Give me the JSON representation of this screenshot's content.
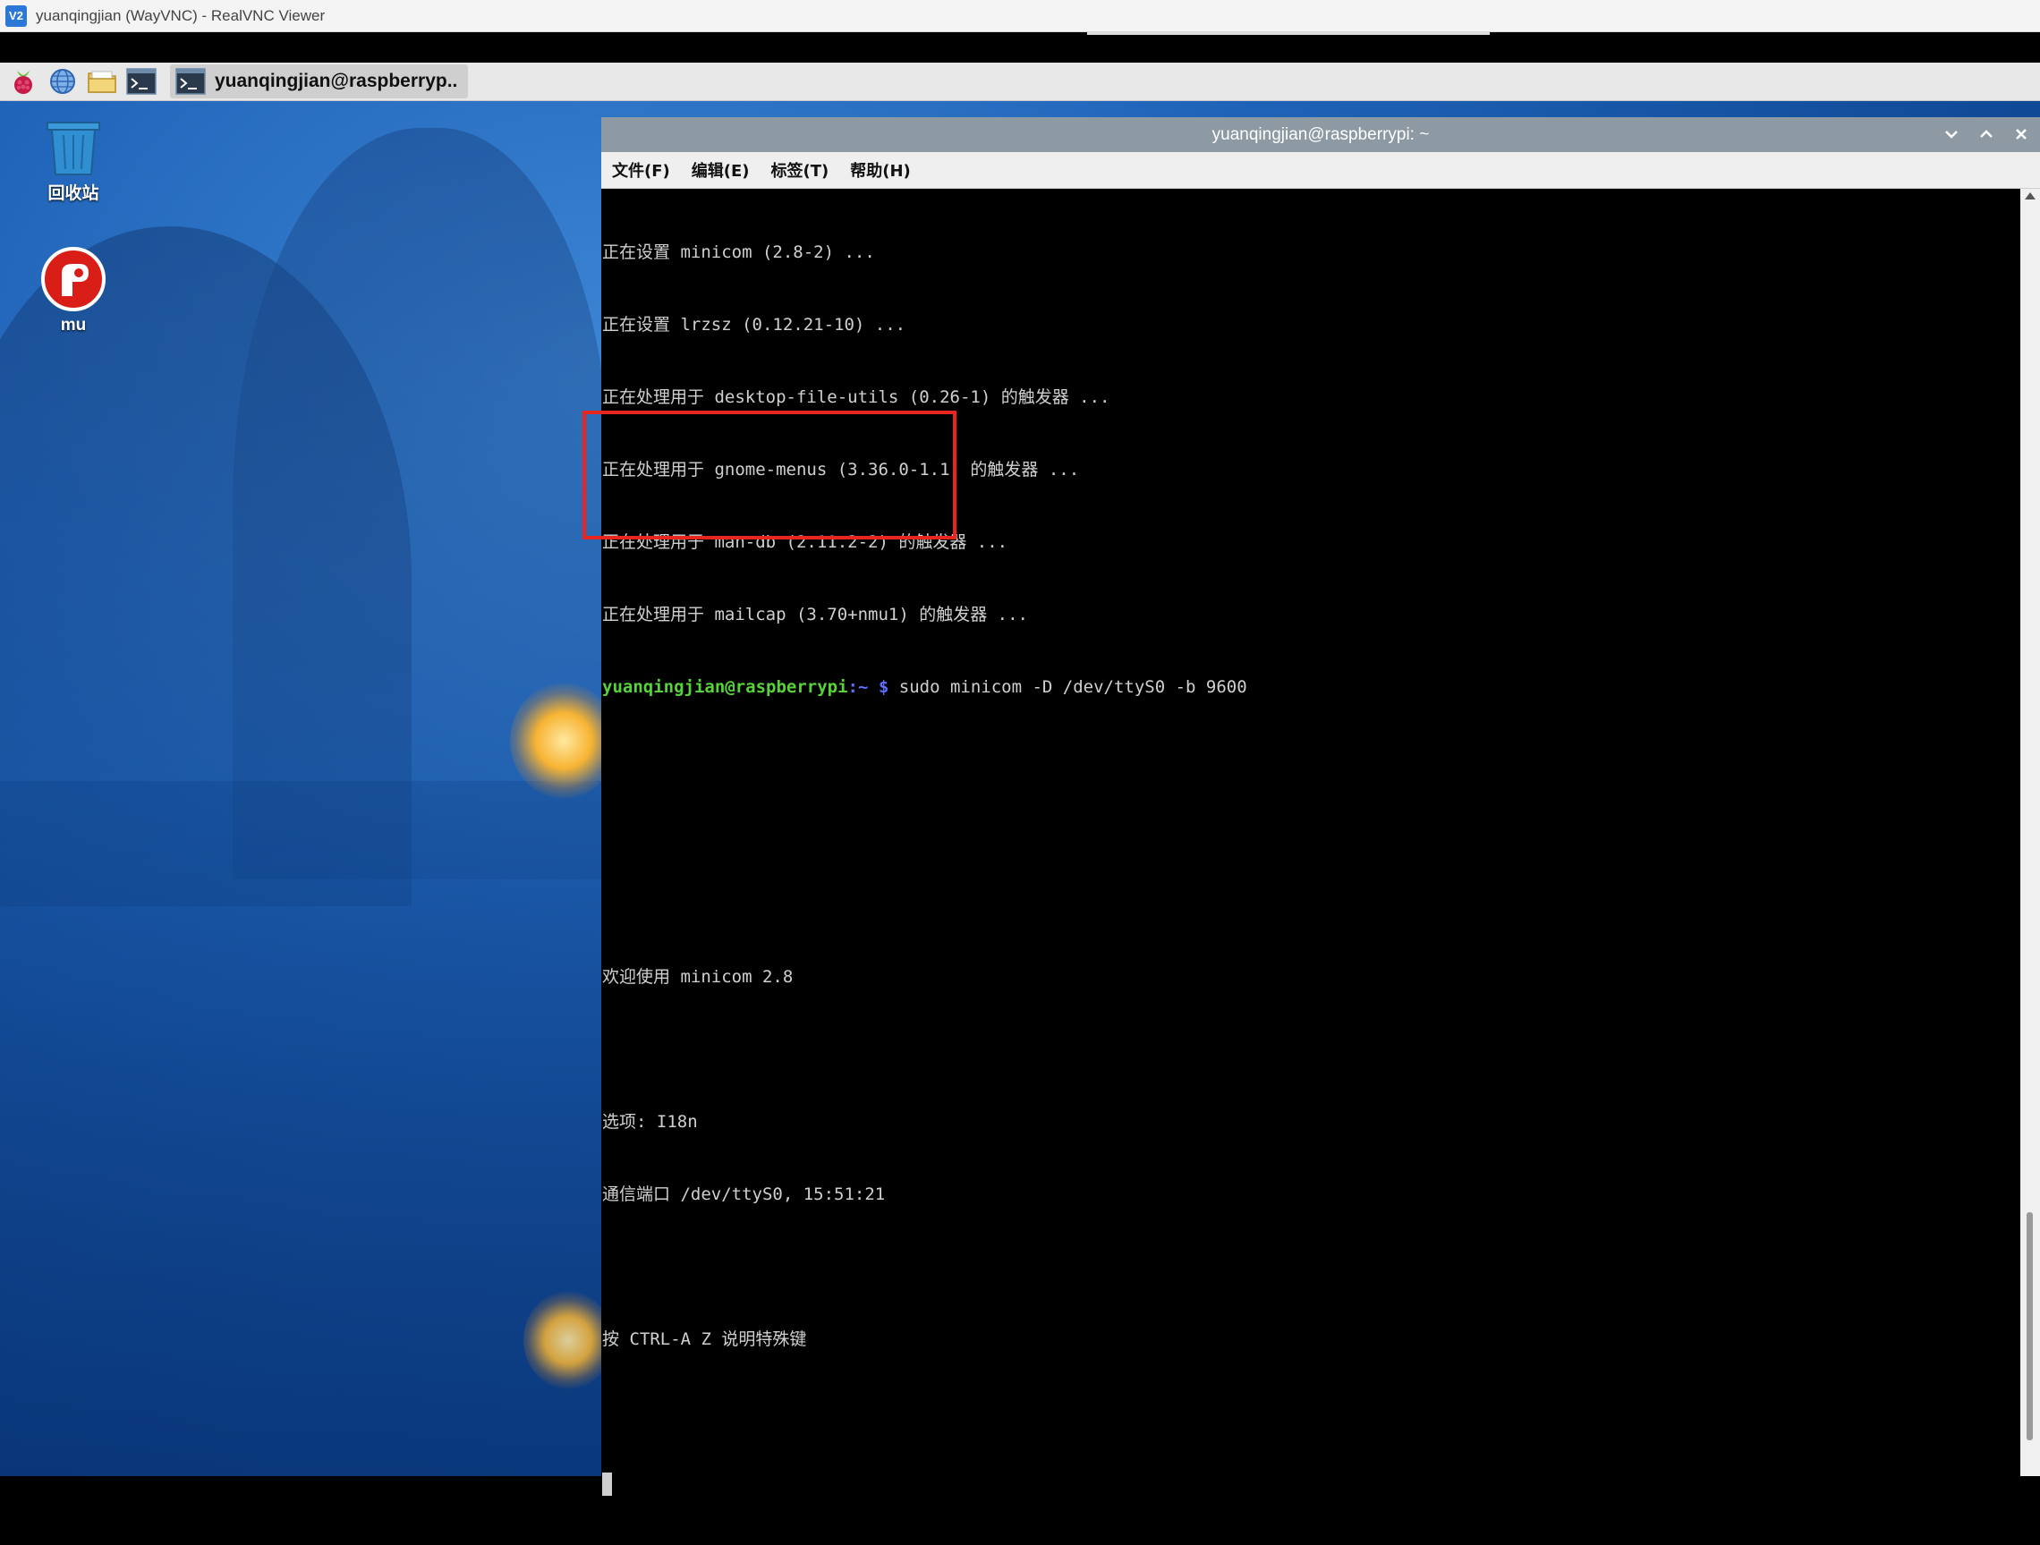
{
  "vnc": {
    "title": "yuanqingjian (WayVNC) - RealVNC Viewer",
    "logo_text": "V2"
  },
  "taskbar": {
    "icons": [
      "raspberry-icon",
      "globe-icon",
      "folder-icon",
      "terminal-icon"
    ],
    "task_label": "yuanqingjian@raspberryp.."
  },
  "desktop": {
    "icons": [
      {
        "name": "trash-icon",
        "label": "回收站"
      },
      {
        "name": "mu-icon",
        "label": "mu"
      }
    ]
  },
  "terminal": {
    "title": "yuanqingjian@raspberrypi: ~",
    "menu": [
      "文件(F)",
      "编辑(E)",
      "标签(T)",
      "帮助(H)"
    ],
    "lines": [
      "正在设置 minicom (2.8-2) ...",
      "正在设置 lrzsz (0.12.21-10) ...",
      "正在处理用于 desktop-file-utils (0.26-1) 的触发器 ...",
      "正在处理用于 gnome-menus (3.36.0-1.1) 的触发器 ...",
      "正在处理用于 man-db (2.11.2-2) 的触发器 ...",
      "正在处理用于 mailcap (3.70+nmu1) 的触发器 ..."
    ],
    "prompt_user": "yuanqingjian@raspberrypi",
    "prompt_path": ":~ $",
    "command": " sudo minicom -D /dev/ttyS0 -b 9600",
    "welcome": "欢迎使用 minicom 2.8",
    "options": "选项: I18n",
    "port": "通信端口 /dev/ttyS0, 15:51:21",
    "hint": "按 CTRL-A Z 说明特殊键"
  },
  "colors": {
    "highlight": "#e8261f",
    "prompt_user": "#57d33a",
    "prompt_path": "#5c6fff"
  }
}
